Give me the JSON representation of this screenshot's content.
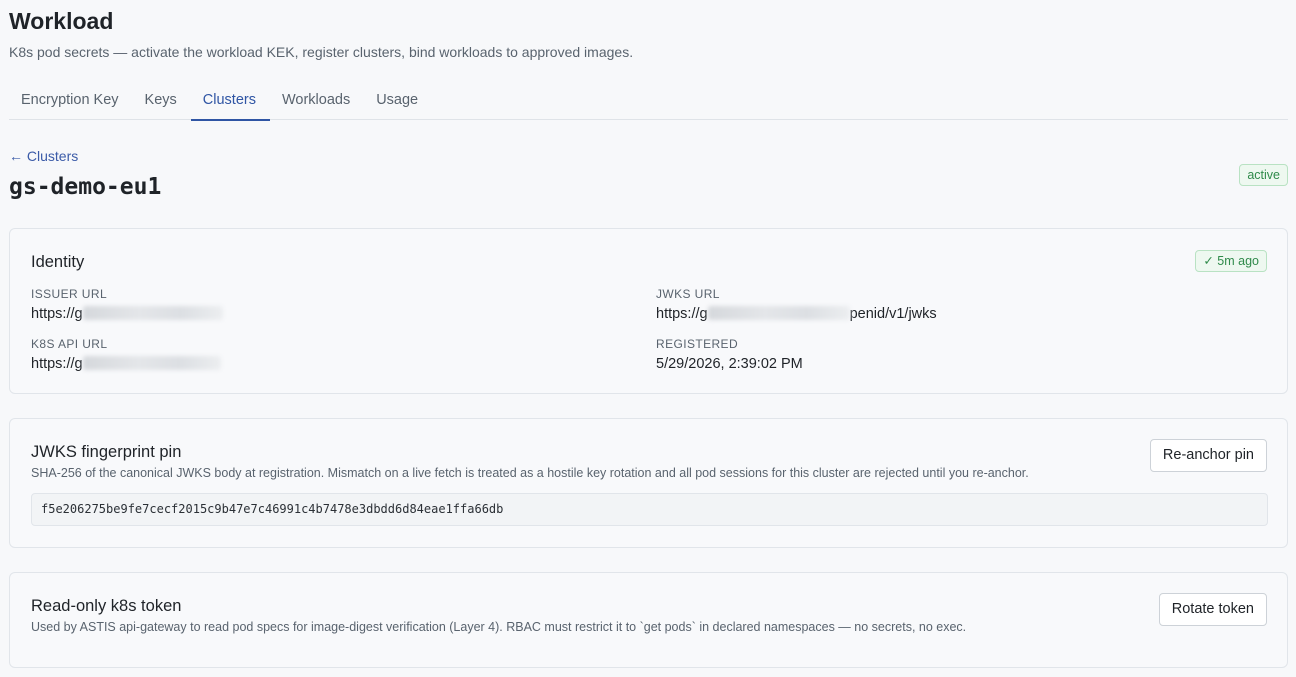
{
  "header": {
    "title": "Workload",
    "subtitle": "K8s pod secrets — activate the workload KEK, register clusters, bind workloads to approved images."
  },
  "tabs": [
    {
      "label": "Encryption Key",
      "active": false
    },
    {
      "label": "Keys",
      "active": false
    },
    {
      "label": "Clusters",
      "active": true
    },
    {
      "label": "Workloads",
      "active": false
    },
    {
      "label": "Usage",
      "active": false
    }
  ],
  "breadcrumb": {
    "back_label": "← Clusters"
  },
  "cluster": {
    "name": "gs-demo-eu1",
    "status": "active"
  },
  "identity": {
    "title": "Identity",
    "freshness": "✓ 5m ago",
    "issuer_url_label": "ISSUER URL",
    "issuer_url_prefix": "https://g",
    "jwks_url_label": "JWKS URL",
    "jwks_url_prefix": "https://g",
    "jwks_url_suffix": "penid/v1/jwks",
    "k8s_api_url_label": "K8S API URL",
    "k8s_api_url_prefix": "https://g",
    "registered_label": "REGISTERED",
    "registered_value": "5/29/2026, 2:39:02 PM"
  },
  "fingerprint": {
    "title": "JWKS fingerprint pin",
    "description": "SHA-256 of the canonical JWKS body at registration. Mismatch on a live fetch is treated as a hostile key rotation and all pod sessions for this cluster are rejected until you re-anchor.",
    "value": "f5e206275be9fe7cecf2015c9b47e7c46991c4b7478e3dbdd6d84eae1ffa66db",
    "button_label": "Re-anchor pin"
  },
  "token": {
    "title": "Read-only k8s token",
    "description": "Used by ASTIS api-gateway to read pod specs for image-digest verification (Layer 4). RBAC must restrict it to `get pods` in declared namespaces — no secrets, no exec.",
    "button_label": "Rotate token"
  },
  "colors": {
    "accent": "#2f55a4",
    "status_green": "#2f8a4a",
    "background": "#f7f8fa"
  }
}
